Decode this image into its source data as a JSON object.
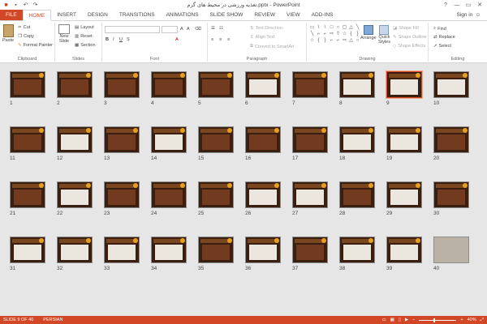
{
  "window": {
    "title": "تغذیه ورزشی در محیط های گرم.pptx - PowerPoint",
    "controls": [
      "?",
      "—",
      "▭",
      "✕"
    ]
  },
  "tabs": [
    "FILE",
    "HOME",
    "INSERT",
    "DESIGN",
    "TRANSITIONS",
    "ANIMATIONS",
    "SLIDE SHOW",
    "REVIEW",
    "VIEW",
    "ADD-INS"
  ],
  "active_tab": "HOME",
  "account": {
    "label": "Sign in"
  },
  "ribbon": {
    "clipboard": {
      "label": "Clipboard",
      "paste": "Paste",
      "cut": "Cut",
      "copy": "Copy",
      "format_painter": "Format Painter"
    },
    "slides": {
      "label": "Slides",
      "new_slide_1": "New",
      "new_slide_2": "Slide",
      "layout": "Layout",
      "reset": "Reset",
      "section": "Section"
    },
    "font": {
      "label": "Font"
    },
    "paragraph": {
      "label": "Paragraph",
      "text_direction": "Text Direction",
      "align_text": "Align Text",
      "convert_smartart": "Convert to SmartArt"
    },
    "drawing": {
      "label": "Drawing",
      "arrange": "Arrange",
      "quick_styles_1": "Quick",
      "quick_styles_2": "Styles",
      "shape_fill": "Shape Fill",
      "shape_outline": "Shape Outline",
      "shape_effects": "Shape Effects"
    },
    "editing": {
      "label": "Editing",
      "find": "Find",
      "replace": "Replace",
      "select": "Select"
    }
  },
  "slides": [
    {
      "n": "1",
      "style": "dark"
    },
    {
      "n": "2",
      "style": "dark"
    },
    {
      "n": "3",
      "style": "dark"
    },
    {
      "n": "4",
      "style": "dark"
    },
    {
      "n": "5",
      "style": "dark"
    },
    {
      "n": "6",
      "style": "light"
    },
    {
      "n": "7",
      "style": "dark"
    },
    {
      "n": "8",
      "style": "light"
    },
    {
      "n": "9",
      "style": "light"
    },
    {
      "n": "10",
      "style": "light"
    },
    {
      "n": "11",
      "style": "dark"
    },
    {
      "n": "12",
      "style": "light"
    },
    {
      "n": "13",
      "style": "dark"
    },
    {
      "n": "14",
      "style": "light"
    },
    {
      "n": "15",
      "style": "dark"
    },
    {
      "n": "16",
      "style": "dark"
    },
    {
      "n": "17",
      "style": "dark"
    },
    {
      "n": "18",
      "style": "light"
    },
    {
      "n": "19",
      "style": "light"
    },
    {
      "n": "20",
      "style": "dark"
    },
    {
      "n": "21",
      "style": "dark"
    },
    {
      "n": "22",
      "style": "light"
    },
    {
      "n": "23",
      "style": "dark"
    },
    {
      "n": "24",
      "style": "dark"
    },
    {
      "n": "25",
      "style": "dark"
    },
    {
      "n": "26",
      "style": "light"
    },
    {
      "n": "27",
      "style": "light"
    },
    {
      "n": "28",
      "style": "dark"
    },
    {
      "n": "29",
      "style": "light"
    },
    {
      "n": "30",
      "style": "dark"
    },
    {
      "n": "31",
      "style": "light"
    },
    {
      "n": "32",
      "style": "light"
    },
    {
      "n": "33",
      "style": "light"
    },
    {
      "n": "34",
      "style": "light"
    },
    {
      "n": "35",
      "style": "dark"
    },
    {
      "n": "36",
      "style": "light"
    },
    {
      "n": "37",
      "style": "dark"
    },
    {
      "n": "38",
      "style": "light"
    },
    {
      "n": "39",
      "style": "light"
    },
    {
      "n": "40",
      "style": "photo"
    }
  ],
  "selected_slide": "9",
  "status": {
    "slide_info": "SLIDE 9 OF 40",
    "language": "PERSIAN",
    "zoom": "40%",
    "zoom_minus": "−",
    "zoom_plus": "+"
  },
  "colors": {
    "accent": "#d24726",
    "slide_bg": "#3a1e0f"
  }
}
